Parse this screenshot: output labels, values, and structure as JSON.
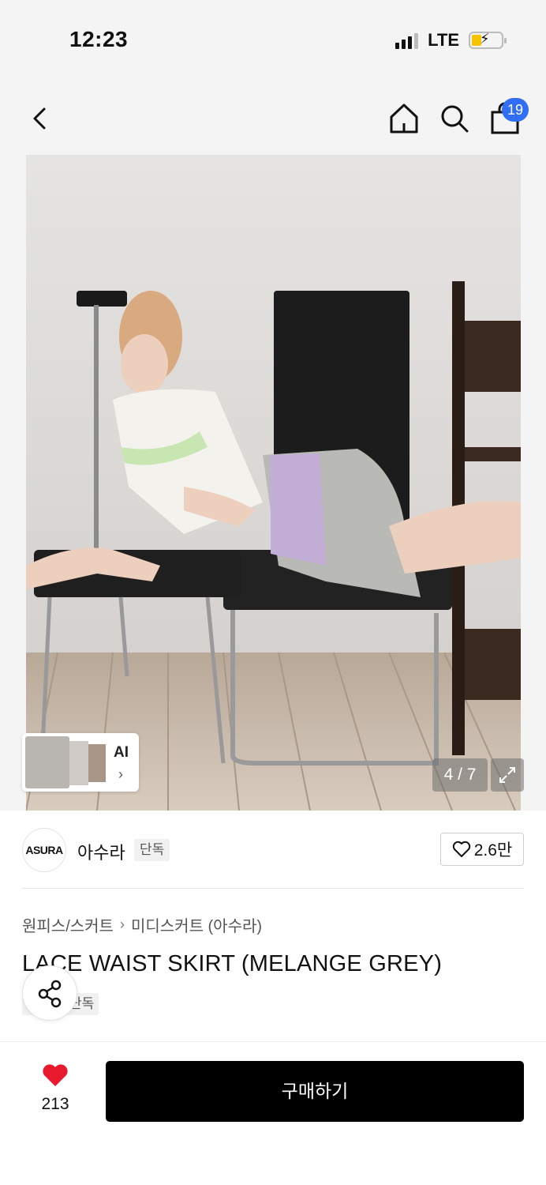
{
  "status_bar": {
    "time": "12:23",
    "network": "LTE"
  },
  "nav": {
    "cart_count": "19"
  },
  "gallery": {
    "counter": "4 / 7",
    "ai_label": "AI"
  },
  "brand": {
    "logo_text": "ASURA",
    "name": "아수라",
    "tag": "단독",
    "likes": "2.6만"
  },
  "product": {
    "breadcrumb": [
      "원피스/스커트",
      "미디스커트 (아수라)"
    ],
    "title": "LACE WAIST SKIRT (MELANGE GREY)",
    "tag": "단독"
  },
  "bottom": {
    "wish_count": "213",
    "buy_label": "구매하기"
  },
  "colors": {
    "accent_badge": "#2f6ef5",
    "heart": "#e8192c",
    "buy_button": "#000000"
  }
}
